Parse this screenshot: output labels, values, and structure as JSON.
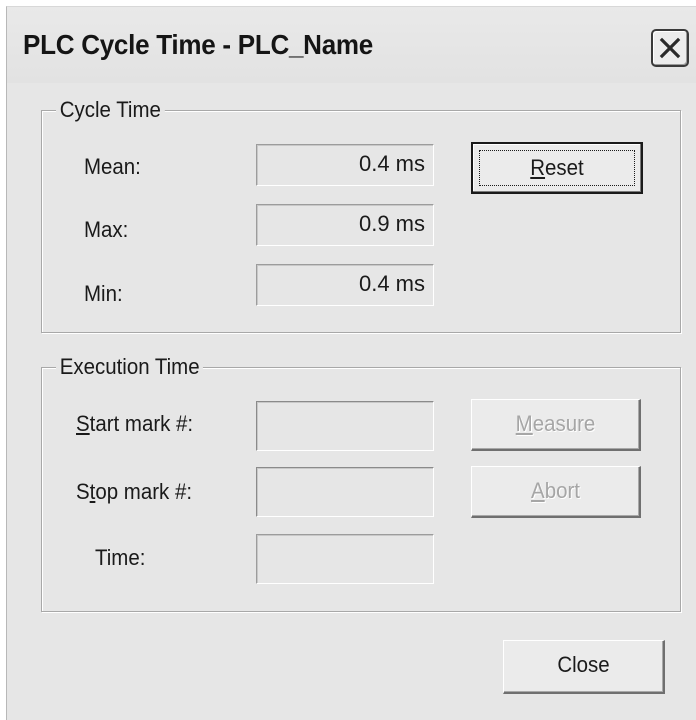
{
  "window": {
    "title": "PLC Cycle Time - PLC_Name"
  },
  "cycle_time": {
    "group_label": "Cycle Time",
    "mean_label": "Mean:",
    "mean_value": "0.4 ms",
    "max_label": "Max:",
    "max_value": "0.9 ms",
    "min_label": "Min:",
    "min_value": "0.4 ms",
    "reset_hotkey": "R",
    "reset_rest": "eset"
  },
  "execution_time": {
    "group_label": "Execution Time",
    "start_hotkey": "S",
    "start_rest": "tart mark #:",
    "start_value": "",
    "stop_first": "S",
    "stop_hotkey": "t",
    "stop_rest": "op mark #:",
    "stop_value": "",
    "time_label": "Time:",
    "time_value": "",
    "measure_hotkey": "M",
    "measure_rest": "easure",
    "abort_hotkey": "A",
    "abort_rest": "bort"
  },
  "footer": {
    "close_label": "Close"
  },
  "icons": {
    "close": "close-icon"
  },
  "colors": {
    "dialog_bg": "#e6e6e6",
    "disabled_text": "#a6a6a6"
  }
}
